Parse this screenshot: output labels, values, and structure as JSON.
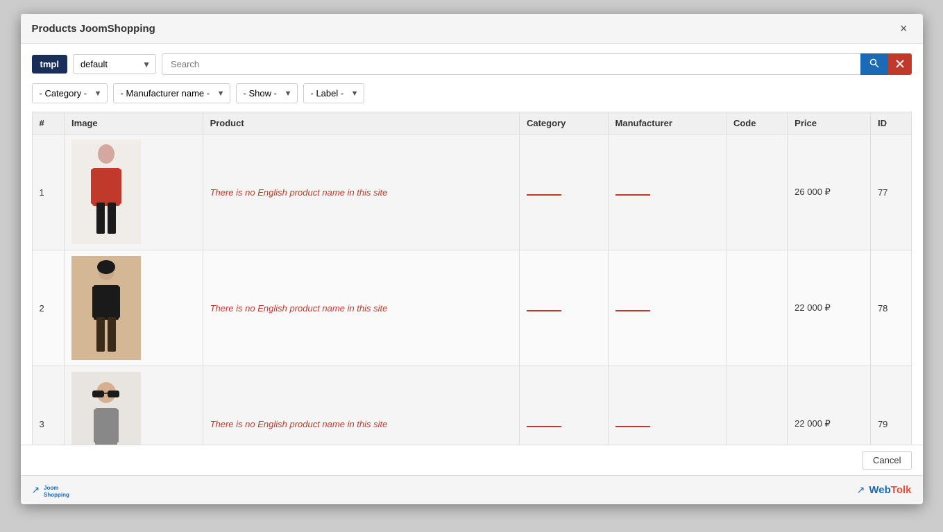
{
  "modal": {
    "title": "Products JoomShopping",
    "close_label": "×"
  },
  "toolbar": {
    "tmpl_label": "tmpl",
    "template_value": "default",
    "search_placeholder": "Search",
    "search_button_title": "Search",
    "clear_button_title": "Clear"
  },
  "filters": {
    "category_label": "- Category -",
    "manufacturer_label": "- Manufacturer name -",
    "show_label": "- Show -",
    "label_label": "- Label -"
  },
  "table": {
    "columns": [
      "#",
      "Image",
      "Product",
      "Category",
      "Manufacturer",
      "Code",
      "Price",
      "ID"
    ],
    "rows": [
      {
        "num": "1",
        "image_desc": "red suit woman",
        "product_text": "There is no English product name in this site",
        "category_line": true,
        "manufacturer_line": true,
        "code": "",
        "price": "26 000 ₽",
        "id": "77"
      },
      {
        "num": "2",
        "image_desc": "black outfit woman",
        "product_text": "There is no English product name in this site",
        "category_line": true,
        "manufacturer_line": true,
        "code": "",
        "price": "22 000 ₽",
        "id": "78"
      },
      {
        "num": "3",
        "image_desc": "sunglasses woman",
        "product_text": "There is no English product name in this site",
        "category_line": true,
        "manufacturer_line": true,
        "code": "",
        "price": "22 000 ₽",
        "id": "79"
      }
    ]
  },
  "footer": {
    "logo_text": "JoomShopping",
    "webtolk_text": "WebTolk",
    "cancel_label": "Cancel"
  }
}
